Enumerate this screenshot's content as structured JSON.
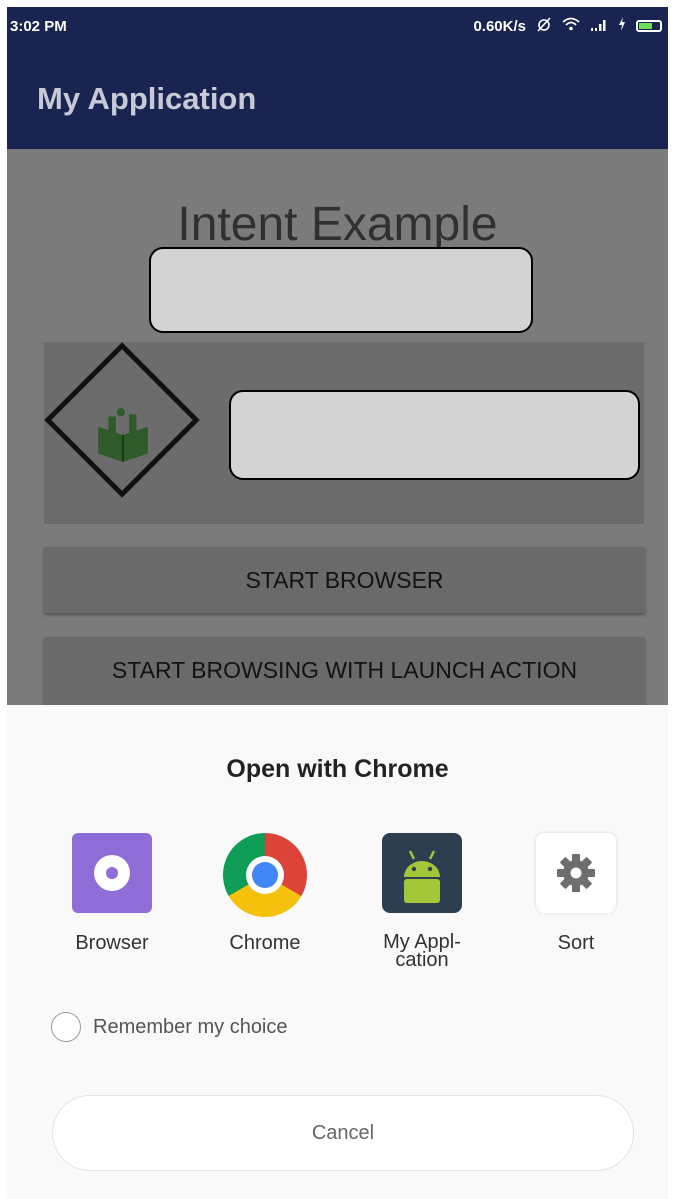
{
  "status_bar": {
    "time": "3:02 PM",
    "network_speed": "0.60K/s",
    "icons": [
      "alarm-off-icon",
      "wifi-icon",
      "signal-icon",
      "battery-charging-icon"
    ]
  },
  "app_bar": {
    "title": "My Application"
  },
  "content": {
    "heading": "Intent Example",
    "start_browser_label": "START BROWSER",
    "launch_action_label": "START BROWSING WITH LAUNCH ACTION"
  },
  "chooser": {
    "title": "Open with Chrome",
    "apps": [
      {
        "label": "Browser",
        "icon": "browser-icon"
      },
      {
        "label": "Chrome",
        "icon": "chrome-icon"
      },
      {
        "label": "My Appl-\ncation",
        "icon": "android-icon"
      },
      {
        "label": "Sort",
        "icon": "gear-icon"
      }
    ],
    "remember_label": "Remember my choice",
    "cancel_label": "Cancel"
  },
  "colors": {
    "app_bar": "#1a2450",
    "scrim": "#7a7a7a",
    "sheet": "#f9f9f9",
    "browser_icon": "#8e6dd6",
    "android_green": "#a4c639"
  }
}
